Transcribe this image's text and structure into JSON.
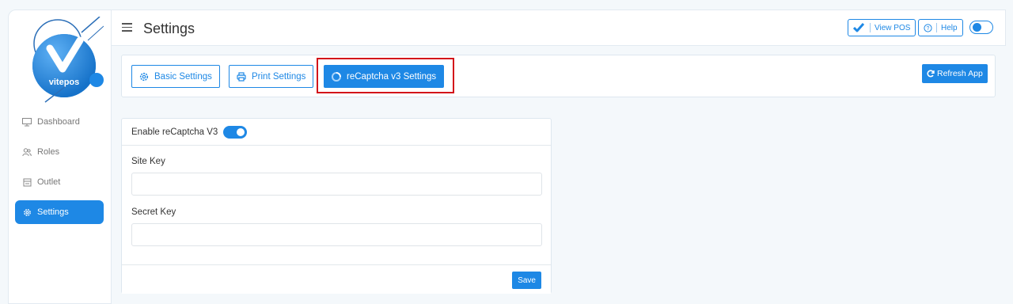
{
  "brand": {
    "logo_text": "vitepos",
    "accent": "#1e88e5",
    "highlight_color": "#d3141a"
  },
  "sidebar": {
    "items": [
      {
        "label": "Dashboard",
        "icon": "dashboard-icon",
        "active": false
      },
      {
        "label": "Roles",
        "icon": "users-icon",
        "active": false
      },
      {
        "label": "Outlet",
        "icon": "outlet-icon",
        "active": false
      },
      {
        "label": "Settings",
        "icon": "gear-icon",
        "active": true
      }
    ]
  },
  "header": {
    "title": "Settings",
    "view_pos_label": "View POS",
    "help_label": "Help"
  },
  "tabs": [
    {
      "label": "Basic Settings",
      "icon": "gear-icon",
      "active": false
    },
    {
      "label": "Print Settings",
      "icon": "printer-icon",
      "active": false
    },
    {
      "label": "reCaptcha v3 Settings",
      "icon": "recaptcha-icon",
      "active": true
    }
  ],
  "refresh_label": "Refresh App",
  "form": {
    "enable_label": "Enable reCaptcha V3",
    "enabled": true,
    "site_key_label": "Site Key",
    "site_key_value": "",
    "secret_key_label": "Secret Key",
    "secret_key_value": "",
    "save_label": "Save"
  }
}
